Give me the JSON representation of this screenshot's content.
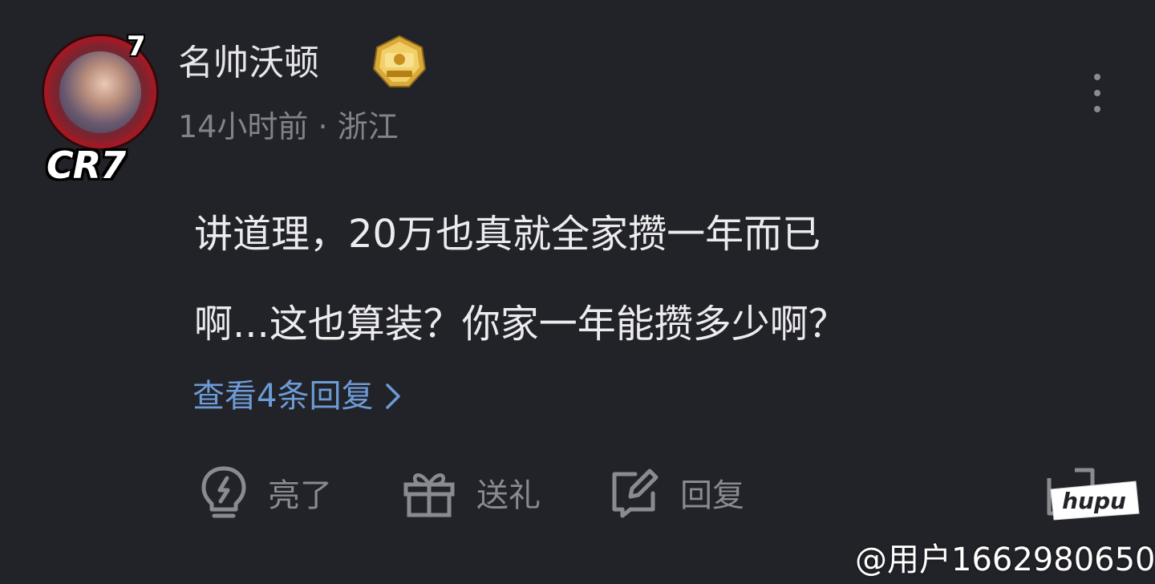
{
  "post": {
    "avatar": {
      "number": "7",
      "badge_text": "CR7"
    },
    "username": "名帅沃顿",
    "user_badge_icon": "gold-level-badge-icon",
    "time": "14小时前",
    "separator": "·",
    "location": "浙江",
    "comment_line1": "讲道理，20万也真就全家攒一年而已",
    "comment_line2": "啊...这也算装？你家一年能攒多少啊？",
    "view_replies": "查看4条回复"
  },
  "actions": {
    "like_label": "亮了",
    "gift_label": "送礼",
    "reply_label": "回复"
  },
  "watermark": {
    "logo_text": "hupu",
    "user": "@用户1662980650"
  },
  "colors": {
    "background": "#222328",
    "primary_text": "#ececee",
    "secondary_text": "#82838a",
    "link": "#6d9bd6",
    "badge_gold": "#d9a93a"
  }
}
